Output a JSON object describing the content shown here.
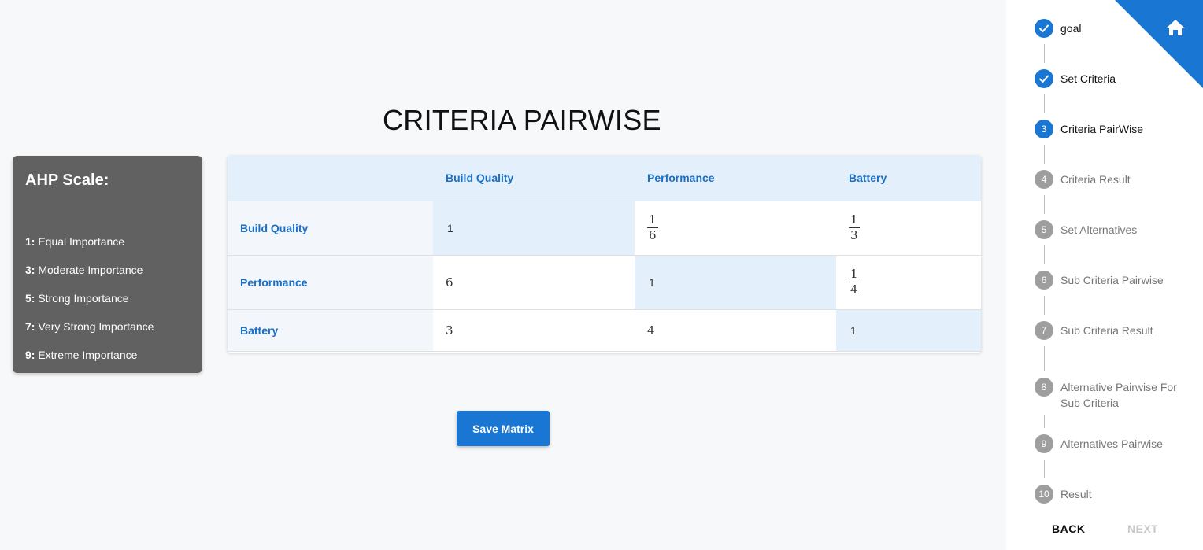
{
  "page": {
    "title": "CRITERIA PAIRWISE"
  },
  "ahp": {
    "title": "AHP Scale:",
    "items": [
      {
        "key": "1:",
        "text": "Equal Importance"
      },
      {
        "key": "3:",
        "text": "Moderate Importance"
      },
      {
        "key": "5:",
        "text": "Strong Importance"
      },
      {
        "key": "7:",
        "text": "Very Strong Importance"
      },
      {
        "key": "9:",
        "text": "Extreme Importance"
      }
    ]
  },
  "matrix": {
    "columns": [
      "Build Quality",
      "Performance",
      "Battery"
    ],
    "rows": [
      {
        "label": "Build Quality",
        "cells": [
          {
            "type": "diag",
            "value": "1"
          },
          {
            "type": "frac",
            "num": "1",
            "den": "6"
          },
          {
            "type": "frac",
            "num": "1",
            "den": "3"
          }
        ]
      },
      {
        "label": "Performance",
        "cells": [
          {
            "type": "val",
            "value": "6"
          },
          {
            "type": "diag",
            "value": "1"
          },
          {
            "type": "frac",
            "num": "1",
            "den": "4"
          }
        ]
      },
      {
        "label": "Battery",
        "cells": [
          {
            "type": "val",
            "value": "3"
          },
          {
            "type": "val",
            "value": "4"
          },
          {
            "type": "diag",
            "value": "1"
          }
        ]
      }
    ]
  },
  "actions": {
    "save": "Save Matrix"
  },
  "stepper": {
    "steps": [
      {
        "num": "1",
        "label": "goal",
        "state": "done"
      },
      {
        "num": "2",
        "label": "Set Criteria",
        "state": "done"
      },
      {
        "num": "3",
        "label": "Criteria PairWise",
        "state": "active"
      },
      {
        "num": "4",
        "label": "Criteria Result",
        "state": "todo"
      },
      {
        "num": "5",
        "label": "Set Alternatives",
        "state": "todo"
      },
      {
        "num": "6",
        "label": "Sub Criteria Pairwise",
        "state": "todo"
      },
      {
        "num": "7",
        "label": "Sub Criteria Result",
        "state": "todo"
      },
      {
        "num": "8",
        "label": "Alternative Pairwise For Sub Criteria",
        "state": "todo"
      },
      {
        "num": "9",
        "label": "Alternatives Pairwise",
        "state": "todo"
      },
      {
        "num": "10",
        "label": "Result",
        "state": "todo"
      }
    ],
    "back": "BACK",
    "next": "NEXT"
  },
  "colors": {
    "accent": "#1976d2",
    "panel": "#616161",
    "header_bg": "#e3f0fb",
    "inactive": "#9e9e9e"
  },
  "icons": {
    "home": "home-icon",
    "check": "check-icon"
  }
}
